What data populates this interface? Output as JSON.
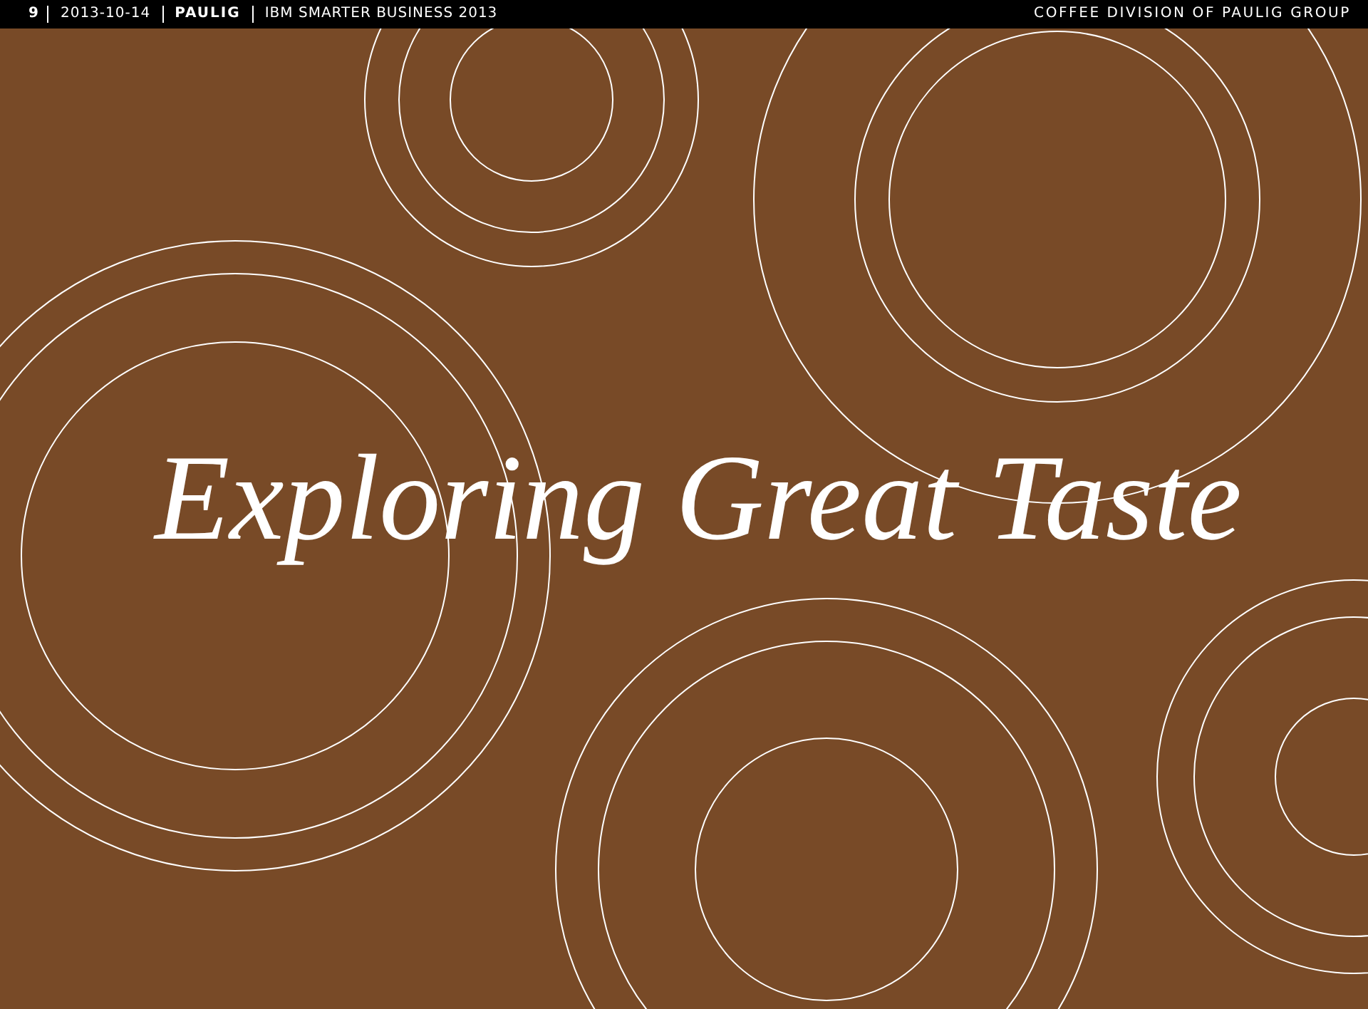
{
  "header": {
    "page_number": "9",
    "date": "2013-10-14",
    "company": "PAULIG",
    "event": "IBM SMARTER BUSINESS 2013",
    "division": "COFFEE DIVISION OF PAULIG GROUP"
  },
  "title": "Exploring Great Taste"
}
